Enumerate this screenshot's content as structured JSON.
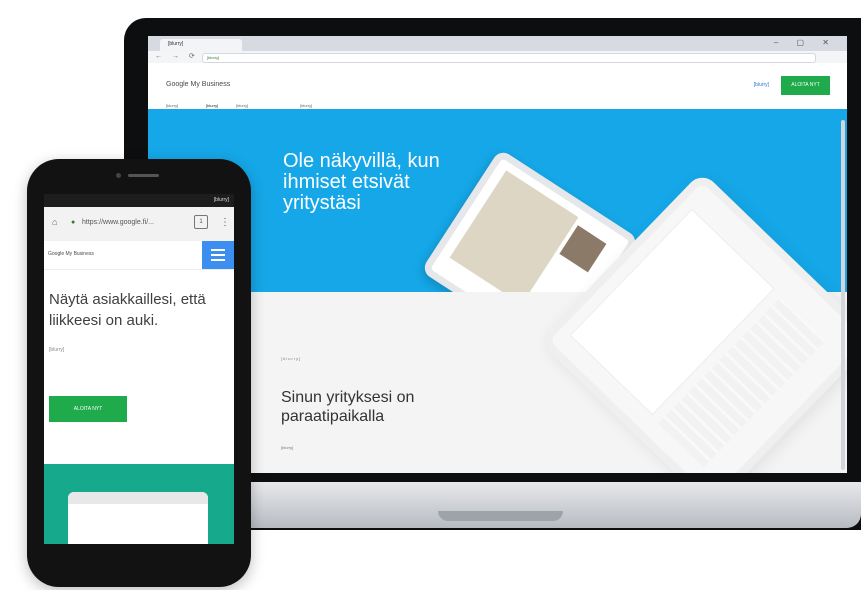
{
  "browser": {
    "tab_title": "[blurry]",
    "window_controls": "–  ▢  ✕",
    "url": "[blurry]"
  },
  "site": {
    "logo_text": "Google My Business",
    "sign_in": "[blurry]",
    "start_button": "ALOITA NYT",
    "nav": [
      "[blurry]",
      "[blurry]",
      "[blurry]",
      "[blurry]"
    ],
    "hero_title": "Ole näkyvillä, kun ihmiset etsivät yritystäsi",
    "kicker": "[blurry]",
    "section_title": "Sinun yrityksesi on paraatipaikalla",
    "section_body": "[blurry]"
  },
  "phone": {
    "status": "[blurry]",
    "url_text": "https://www.google.fi/...",
    "logo_text": "Google My Business",
    "title": "Näytä asiakkaillesi, että liikkeesi on auki.",
    "copy": "[blurry]",
    "start_button": "ALOITA NYT"
  },
  "colors": {
    "hero": "#15a7e8",
    "cta": "#1faa4b",
    "phone_menu": "#3c8ef0",
    "phone_green": "#16a98c"
  }
}
